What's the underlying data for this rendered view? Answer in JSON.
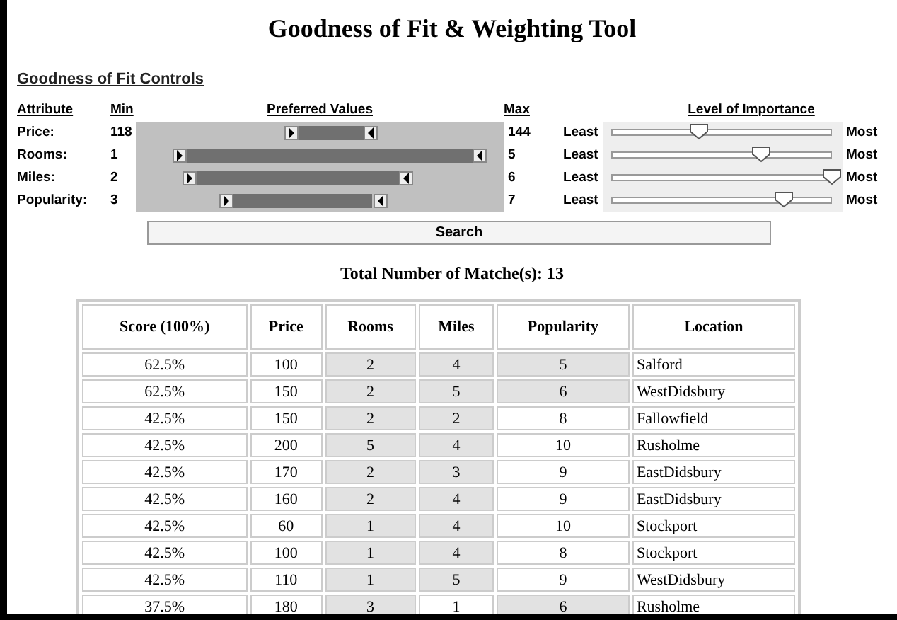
{
  "title": "Goodness of Fit & Weighting Tool",
  "section_title": "Goodness of Fit Controls",
  "controls_header": {
    "attribute": "Attribute",
    "min": "Min",
    "preferred": "Preferred Values",
    "max": "Max",
    "importance": "Level of Importance"
  },
  "controls": [
    {
      "attribute": "Price:",
      "min": "118",
      "low_thumb": {
        "level": 0.42
      },
      "high_thumb": {
        "level": 0.62
      },
      "max": "144",
      "least": "Least",
      "importance": {
        "level": 0.4
      },
      "most": "Most"
    },
    {
      "attribute": "Rooms:",
      "min": "1",
      "low_thumb": {
        "level": 0.08
      },
      "high_thumb": {
        "level": 0.955
      },
      "max": "5",
      "least": "Least",
      "importance": {
        "level": 0.68
      },
      "most": "Most"
    },
    {
      "attribute": "Miles:",
      "min": "2",
      "low_thumb": {
        "level": 0.11
      },
      "high_thumb": {
        "level": 0.73
      },
      "max": "6",
      "least": "Least",
      "importance": {
        "level": 1.0
      },
      "most": "Most"
    },
    {
      "attribute": "Popularity:",
      "min": "3",
      "low_thumb": {
        "level": 0.22
      },
      "high_thumb": {
        "level": 0.65
      },
      "max": "7",
      "least": "Least",
      "importance": {
        "level": 0.78
      },
      "most": "Most"
    }
  ],
  "search_button": "Search",
  "total_matches": "Total Number of Matche(s): 13",
  "table": {
    "columns": [
      "Score (100%)",
      "Price",
      "Rooms",
      "Miles",
      "Popularity",
      "Location"
    ],
    "rows": [
      {
        "cells": [
          {
            "text": "62.5%",
            "highlighted": false
          },
          {
            "text": "100",
            "highlighted": false
          },
          {
            "text": "2",
            "highlighted": true
          },
          {
            "text": "4",
            "highlighted": true
          },
          {
            "text": "5",
            "highlighted": true
          },
          {
            "text": "Salford",
            "highlighted": false
          }
        ]
      },
      {
        "cells": [
          {
            "text": "62.5%",
            "highlighted": false
          },
          {
            "text": "150",
            "highlighted": false
          },
          {
            "text": "2",
            "highlighted": true
          },
          {
            "text": "5",
            "highlighted": true
          },
          {
            "text": "6",
            "highlighted": true
          },
          {
            "text": "WestDidsbury",
            "highlighted": false
          }
        ]
      },
      {
        "cells": [
          {
            "text": "42.5%",
            "highlighted": false
          },
          {
            "text": "150",
            "highlighted": false
          },
          {
            "text": "2",
            "highlighted": true
          },
          {
            "text": "2",
            "highlighted": true
          },
          {
            "text": "8",
            "highlighted": false
          },
          {
            "text": "Fallowfield",
            "highlighted": false
          }
        ]
      },
      {
        "cells": [
          {
            "text": "42.5%",
            "highlighted": false
          },
          {
            "text": "200",
            "highlighted": false
          },
          {
            "text": "5",
            "highlighted": true
          },
          {
            "text": "4",
            "highlighted": true
          },
          {
            "text": "10",
            "highlighted": false
          },
          {
            "text": "Rusholme",
            "highlighted": false
          }
        ]
      },
      {
        "cells": [
          {
            "text": "42.5%",
            "highlighted": false
          },
          {
            "text": "170",
            "highlighted": false
          },
          {
            "text": "2",
            "highlighted": true
          },
          {
            "text": "3",
            "highlighted": true
          },
          {
            "text": "9",
            "highlighted": false
          },
          {
            "text": "EastDidsbury",
            "highlighted": false
          }
        ]
      },
      {
        "cells": [
          {
            "text": "42.5%",
            "highlighted": false
          },
          {
            "text": "160",
            "highlighted": false
          },
          {
            "text": "2",
            "highlighted": true
          },
          {
            "text": "4",
            "highlighted": true
          },
          {
            "text": "9",
            "highlighted": false
          },
          {
            "text": "EastDidsbury",
            "highlighted": false
          }
        ]
      },
      {
        "cells": [
          {
            "text": "42.5%",
            "highlighted": false
          },
          {
            "text": "60",
            "highlighted": false
          },
          {
            "text": "1",
            "highlighted": true
          },
          {
            "text": "4",
            "highlighted": true
          },
          {
            "text": "10",
            "highlighted": false
          },
          {
            "text": "Stockport",
            "highlighted": false
          }
        ]
      },
      {
        "cells": [
          {
            "text": "42.5%",
            "highlighted": false
          },
          {
            "text": "100",
            "highlighted": false
          },
          {
            "text": "1",
            "highlighted": true
          },
          {
            "text": "4",
            "highlighted": true
          },
          {
            "text": "8",
            "highlighted": false
          },
          {
            "text": "Stockport",
            "highlighted": false
          }
        ]
      },
      {
        "cells": [
          {
            "text": "42.5%",
            "highlighted": false
          },
          {
            "text": "110",
            "highlighted": false
          },
          {
            "text": "1",
            "highlighted": true
          },
          {
            "text": "5",
            "highlighted": true
          },
          {
            "text": "9",
            "highlighted": false
          },
          {
            "text": "WestDidsbury",
            "highlighted": false
          }
        ]
      },
      {
        "cells": [
          {
            "text": "37.5%",
            "highlighted": false
          },
          {
            "text": "180",
            "highlighted": false
          },
          {
            "text": "3",
            "highlighted": true
          },
          {
            "text": "1",
            "highlighted": false
          },
          {
            "text": "6",
            "highlighted": true
          },
          {
            "text": "Rusholme",
            "highlighted": false
          }
        ]
      }
    ]
  }
}
